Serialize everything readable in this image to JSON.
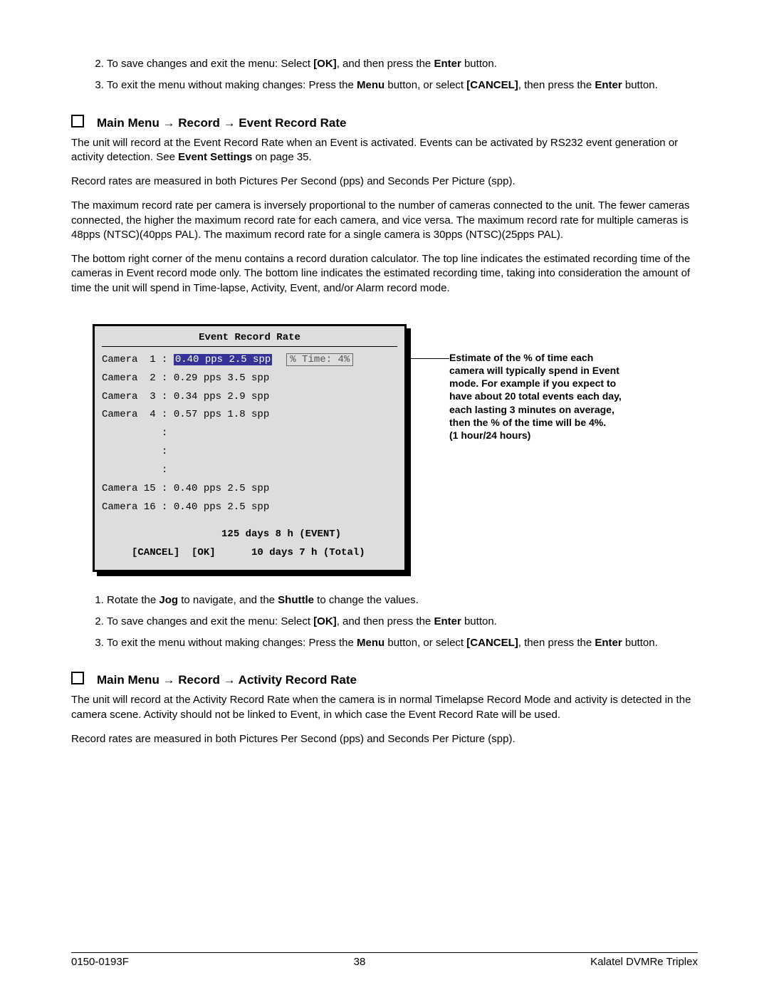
{
  "top_list": {
    "item2_pre": "To save changes and exit the menu:  Select ",
    "item2_ok": "[OK]",
    "item2_mid": ", and then press the ",
    "item2_enter": "Enter",
    "item2_post": " button.",
    "item3_pre": "To exit the menu without making changes:  Press the ",
    "item3_menu": "Menu",
    "item3_mid1": " button, or select ",
    "item3_cancel": "[CANCEL]",
    "item3_mid2": ", then press the ",
    "item3_enter": "Enter",
    "item3_post": " button."
  },
  "section1": {
    "heading": "Main Menu → Record → Event Record Rate",
    "p1_pre": "The unit will record at the Event Record Rate when an Event is activated.  Events can be activated by RS232 event generation or activity detection.  See ",
    "p1_bold": "Event Settings",
    "p1_post": " on page 35.",
    "p2": "Record rates are measured in both Pictures Per Second (pps) and Seconds Per Picture (spp).",
    "p3": "The maximum record rate per camera is inversely proportional to the number of cameras connected to the unit. The fewer cameras connected, the higher the maximum record rate for each camera, and vice versa.  The maximum record rate for multiple cameras is 48pps (NTSC)(40pps PAL).  The maximum record rate for a single camera is 30pps (NTSC)(25pps PAL).",
    "p4": "The bottom right corner of the menu contains a record duration calculator.  The top line indicates the estimated recording time of the cameras in Event record mode only.  The bottom line indicates the estimated recording time, taking into consideration the amount of time the unit will spend in Time-lapse, Activity, Event, and/or Alarm record mode."
  },
  "menu": {
    "title": "Event Record Rate",
    "row1_label": "Camera  1 : ",
    "row1_hl": "0.40 pps 2.5 spp",
    "row1_time": "% Time: 4%",
    "row2": "Camera  2 : 0.29 pps 3.5 spp",
    "row3": "Camera  3 : 0.34 pps 2.9 spp",
    "row4": "Camera  4 : 0.57 pps 1.8 spp",
    "dots1": "          :",
    "dots2": "          :",
    "dots3": "          :",
    "row15": "Camera 15 : 0.40 pps 2.5 spp",
    "row16": "Camera 16 : 0.40 pps 2.5 spp",
    "footer1": "                    125 days 8 h (EVENT)",
    "footer2": "     [CANCEL]  [OK]      10 days 7 h (Total)"
  },
  "callout": "Estimate of the % of time each camera will typically spend in Event mode. For example if you expect to have about 20 total events each day, each lasting 3 minutes on average, then the % of the time will be 4%.\n(1 hour/24 hours)",
  "steps": {
    "s1_pre": "Rotate the ",
    "s1_jog": "Jog",
    "s1_mid": " to navigate, and the ",
    "s1_shuttle": "Shuttle",
    "s1_post": " to change the values.",
    "s2_pre": "To save changes and exit the menu:  Select ",
    "s2_ok": "[OK]",
    "s2_mid": ", and then press the ",
    "s2_enter": "Enter",
    "s2_post": " button.",
    "s3_pre": "To exit the menu without making changes:  Press the ",
    "s3_menu": "Menu",
    "s3_mid1": " button, or select ",
    "s3_cancel": "[CANCEL]",
    "s3_mid2": ", then press the ",
    "s3_enter": "Enter",
    "s3_post": " button."
  },
  "section2": {
    "heading": "Main Menu → Record → Activity Record Rate",
    "p1": "The unit will record at the Activity Record Rate when the camera is in normal Timelapse Record Mode and activity is detected in the camera scene. Activity should not be linked to Event, in which case the Event Record Rate will be used.",
    "p2": "Record rates are measured in both Pictures Per Second (pps) and Seconds Per Picture (spp)."
  },
  "footer": {
    "left": "0150-0193F",
    "center": "38",
    "right": "Kalatel DVMRe Triplex"
  }
}
